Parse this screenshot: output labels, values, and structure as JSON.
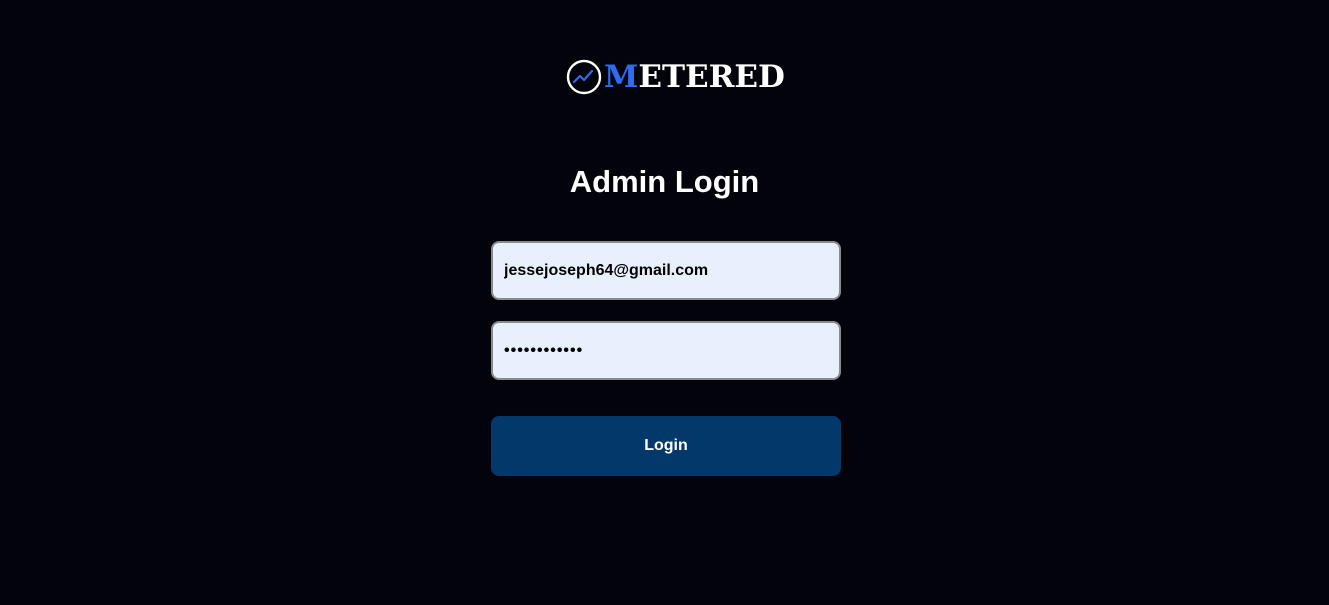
{
  "brand": {
    "logo_icon": "trend-chart-circle-icon",
    "name_first_letter": "M",
    "name_rest": "ETERED",
    "accent_color": "#2f6cf0"
  },
  "login_form": {
    "title": "Admin Login",
    "email_value": "jessejoseph64@gmail.com",
    "password_value": "••••••••••••",
    "submit_label": "Login",
    "button_color": "#03386b",
    "field_background": "#e8f0fe"
  },
  "theme": {
    "background": "#02030b",
    "text": "#ffffff"
  }
}
